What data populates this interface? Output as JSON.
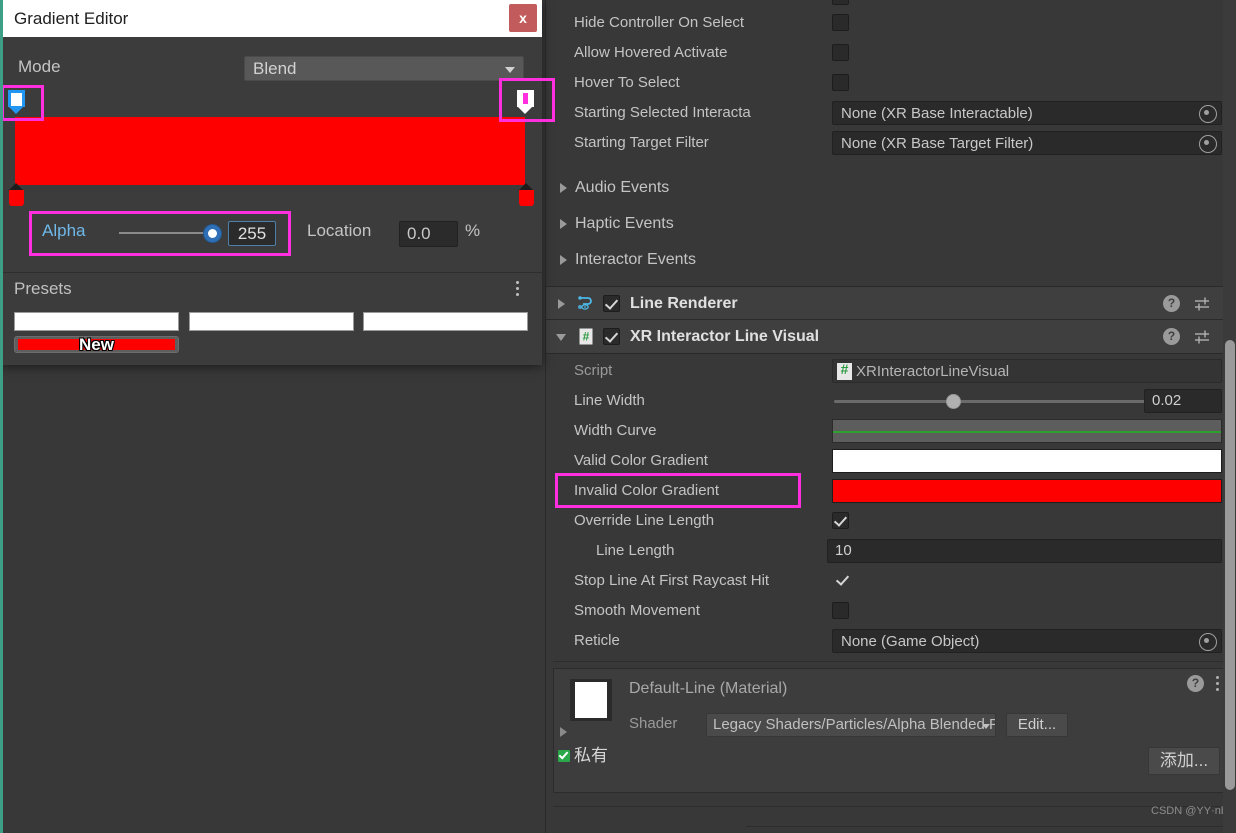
{
  "gradient_editor": {
    "title": "Gradient Editor",
    "close_label": "x",
    "mode_label": "Mode",
    "mode_value": "Blend",
    "gradient_color": "#ff0000",
    "alpha_label": "Alpha",
    "alpha_value": "255",
    "location_label": "Location",
    "location_value": "0.0",
    "percent_symbol": "%",
    "presets_label": "Presets",
    "preset_swatches": [
      "#ffffff",
      "#ffffff",
      "#ffffff"
    ],
    "new_button_label": "New",
    "new_button_color": "#ff0000"
  },
  "inspector": {
    "properties": [
      {
        "label": "Hide Controller On Select",
        "type": "checkbox",
        "value": false
      },
      {
        "label": "Allow Hovered Activate",
        "type": "checkbox",
        "value": false
      },
      {
        "label": "Hover To Select",
        "type": "checkbox",
        "value": false
      },
      {
        "label": "Starting Selected Interacta",
        "type": "object",
        "value": "None (XR Base Interactable)"
      },
      {
        "label": "Starting Target Filter",
        "type": "object",
        "value": "None (XR Base Target Filter)"
      }
    ],
    "foldouts": [
      {
        "label": "Audio Events",
        "expanded": false
      },
      {
        "label": "Haptic Events",
        "expanded": false
      },
      {
        "label": "Interactor Events",
        "expanded": false
      }
    ],
    "components": [
      {
        "title": "Line Renderer",
        "enabled": true,
        "expanded": false,
        "icon": "line-renderer-icon"
      },
      {
        "title": "XR Interactor Line Visual",
        "enabled": true,
        "expanded": true,
        "icon": "script-icon"
      }
    ],
    "line_visual_props": {
      "script_label": "Script",
      "script_value": "XRInteractorLineVisual",
      "line_width_label": "Line Width",
      "line_width_value": "0.02",
      "width_curve_label": "Width Curve",
      "valid_color_gradient_label": "Valid Color Gradient",
      "valid_color_gradient_color": "#ffffff",
      "invalid_color_gradient_label": "Invalid Color Gradient",
      "invalid_color_gradient_color": "#ff0000",
      "override_line_length_label": "Override Line Length",
      "override_line_length_value": true,
      "line_length_label": "Line Length",
      "line_length_value": "10",
      "stop_line_label": "Stop Line At First Raycast Hit",
      "stop_line_value": true,
      "smooth_movement_label": "Smooth Movement",
      "smooth_movement_value": false,
      "reticle_label": "Reticle",
      "reticle_value": "None (Game Object)"
    },
    "material": {
      "title": "Default-Line (Material)",
      "shader_label": "Shader",
      "shader_value": "Legacy Shaders/Particles/Alpha Blended Premu",
      "edit_label": "Edit...",
      "private_label": "私有",
      "add_label": "添加..."
    }
  },
  "watermark": "CSDN @YY·nb",
  "accent": {
    "annotation": "#ff2fe0",
    "selected_text": "#6fb8e8",
    "close_button": "#c25b5b"
  }
}
